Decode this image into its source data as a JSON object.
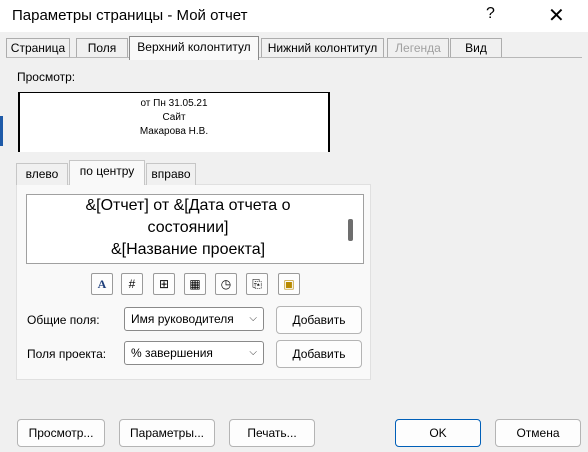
{
  "window": {
    "title": "Параметры страницы - Мой отчет",
    "help_icon": "?",
    "close_icon": "✕"
  },
  "tabs": [
    {
      "label": "Страница",
      "state": "normal"
    },
    {
      "label": "Поля",
      "state": "normal"
    },
    {
      "label": "Верхний колонтитул",
      "state": "active"
    },
    {
      "label": "Нижний колонтитул",
      "state": "normal"
    },
    {
      "label": "Легенда",
      "state": "disabled"
    },
    {
      "label": "Вид",
      "state": "normal"
    }
  ],
  "preview": {
    "label": "Просмотр:",
    "lines": [
      "от Пн 31.05.21",
      "Сайт",
      "Макарова Н.В."
    ]
  },
  "alignment_tabs": [
    {
      "label": "влево"
    },
    {
      "label": "по центру"
    },
    {
      "label": "вправо"
    }
  ],
  "editor": {
    "lines": [
      "&[Отчет] от &[Дата отчета о",
      "состоянии]",
      "&[Название проекта]"
    ]
  },
  "format_buttons": [
    {
      "name": "font-icon",
      "glyph": "A"
    },
    {
      "name": "page-number-icon",
      "glyph": "#"
    },
    {
      "name": "total-pages-icon",
      "glyph": "⊞"
    },
    {
      "name": "insert-date-icon",
      "glyph": "▦"
    },
    {
      "name": "insert-time-icon",
      "glyph": "◷"
    },
    {
      "name": "insert-file-name-icon",
      "glyph": "⎘"
    },
    {
      "name": "insert-picture-icon",
      "glyph": "▣"
    }
  ],
  "general_fields": {
    "label": "Общие поля:",
    "value": "Имя руководителя",
    "button": "Добавить"
  },
  "project_fields": {
    "label": "Поля проекта:",
    "value": "% завершения",
    "button": "Добавить"
  },
  "footer": {
    "preview_button": "Просмотр...",
    "options_button": "Параметры...",
    "print_button": "Печать...",
    "ok_button": "OK",
    "cancel_button": "Отмена"
  },
  "colors": {
    "accent": "#005fb8",
    "background": "#f0f0f0"
  }
}
